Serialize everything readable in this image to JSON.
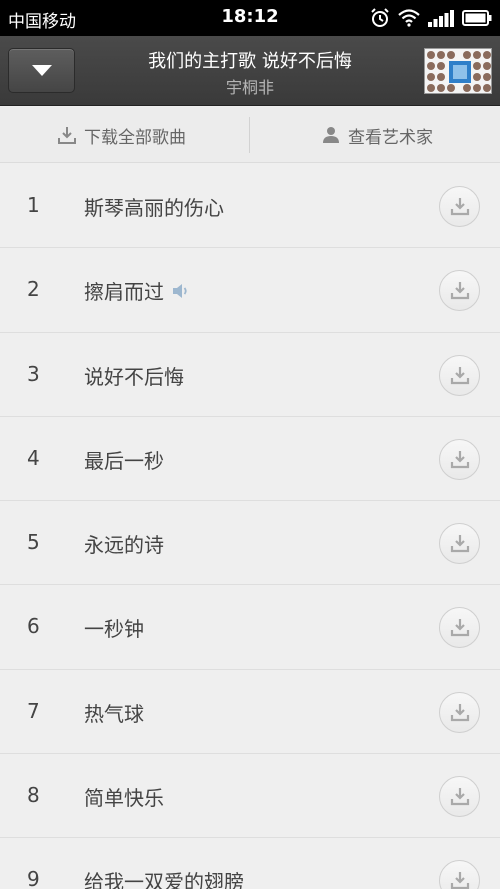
{
  "status_bar": {
    "carrier": "中国移动",
    "time": "18:12",
    "icons": [
      "alarm-icon",
      "wifi-icon",
      "signal-icon",
      "battery-icon"
    ]
  },
  "header": {
    "back_icon": "chevron-down-icon",
    "title": "我们的主打歌 说好不后悔",
    "artist": "宇桐非"
  },
  "actions": {
    "download_all": "下载全部歌曲",
    "view_artist": "查看艺术家"
  },
  "songs": [
    {
      "num": "1",
      "title": "斯琴高丽的伤心",
      "playing": false
    },
    {
      "num": "2",
      "title": "擦肩而过",
      "playing": true
    },
    {
      "num": "3",
      "title": "说好不后悔",
      "playing": false
    },
    {
      "num": "4",
      "title": "最后一秒",
      "playing": false
    },
    {
      "num": "5",
      "title": "永远的诗",
      "playing": false
    },
    {
      "num": "6",
      "title": "一秒钟",
      "playing": false
    },
    {
      "num": "7",
      "title": "热气球",
      "playing": false
    },
    {
      "num": "8",
      "title": "简单快乐",
      "playing": false
    },
    {
      "num": "9",
      "title": "给我一双爱的翅膀",
      "playing": false
    }
  ],
  "colors": {
    "accent_playing": "#9db7cf",
    "text": "#444444",
    "header_bg": "#3f3f3f"
  }
}
